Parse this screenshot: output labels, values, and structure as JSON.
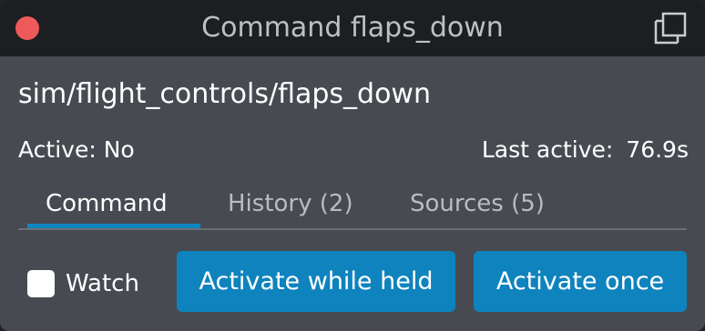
{
  "window": {
    "title": "Command flaps_down",
    "close_color": "#ee5a5a",
    "popout_icon": "popout-icon"
  },
  "command": {
    "path": "sim/flight_controls/flaps_down"
  },
  "status": {
    "active_text": "Active: No",
    "last_active_label": "Last active:",
    "last_active_value": "76.9s"
  },
  "tabs": [
    {
      "label": "Command",
      "active": true
    },
    {
      "label": "History (2)",
      "active": false
    },
    {
      "label": "Sources (5)",
      "active": false
    }
  ],
  "controls": {
    "watch_label": "Watch",
    "watch_checked": false,
    "activate_held_label": "Activate while held",
    "activate_once_label": "Activate once"
  },
  "colors": {
    "accent": "#0f83bd",
    "background": "#474b51",
    "titlebar": "#1d1e21"
  }
}
